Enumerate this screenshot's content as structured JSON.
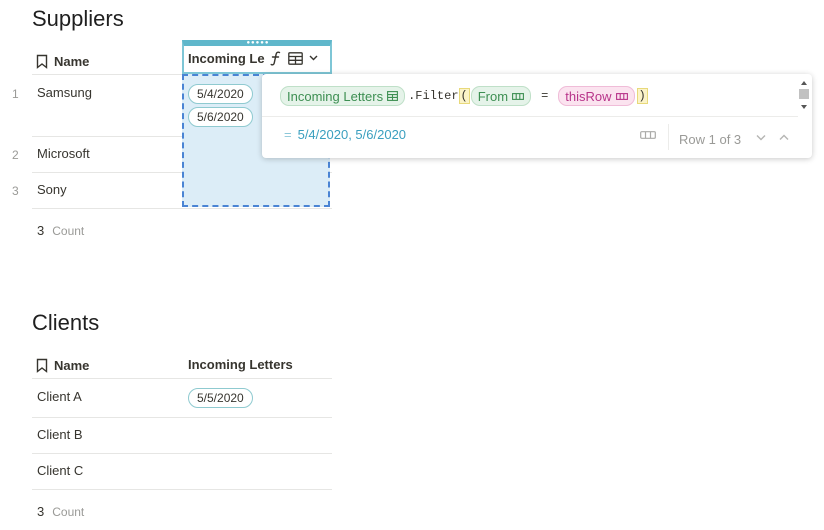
{
  "suppliers": {
    "title": "Suppliers",
    "columns": {
      "name": "Name",
      "letters": "Incoming Le"
    },
    "rows": [
      {
        "num": "1",
        "name": "Samsung",
        "letters": [
          "5/4/2020",
          "5/6/2020"
        ]
      },
      {
        "num": "2",
        "name": "Microsoft",
        "letters": []
      },
      {
        "num": "3",
        "name": "Sony",
        "letters": []
      }
    ],
    "count": {
      "value": "3",
      "label": "Count"
    }
  },
  "formula_popup": {
    "table_pill": "Incoming Letters",
    "method": ".Filter",
    "open_paren": "(",
    "field_pill": "From",
    "operator": "=",
    "this_row_pill": "thisRow",
    "close_paren": ")",
    "result_prefix": "=",
    "result": "5/4/2020, 5/6/2020",
    "row_indicator": "Row 1 of 3"
  },
  "clients": {
    "title": "Clients",
    "columns": {
      "name": "Name",
      "letters": "Incoming Letters"
    },
    "rows": [
      {
        "name": "Client A",
        "letters": [
          "5/5/2020"
        ]
      },
      {
        "name": "Client B",
        "letters": []
      },
      {
        "name": "Client C",
        "letters": []
      }
    ],
    "count": {
      "value": "3",
      "label": "Count"
    }
  },
  "colors": {
    "accent": "#4a84d4",
    "selection": "#dcedf7",
    "chip_border": "#8fcad0",
    "result": "#3a9fbf"
  }
}
